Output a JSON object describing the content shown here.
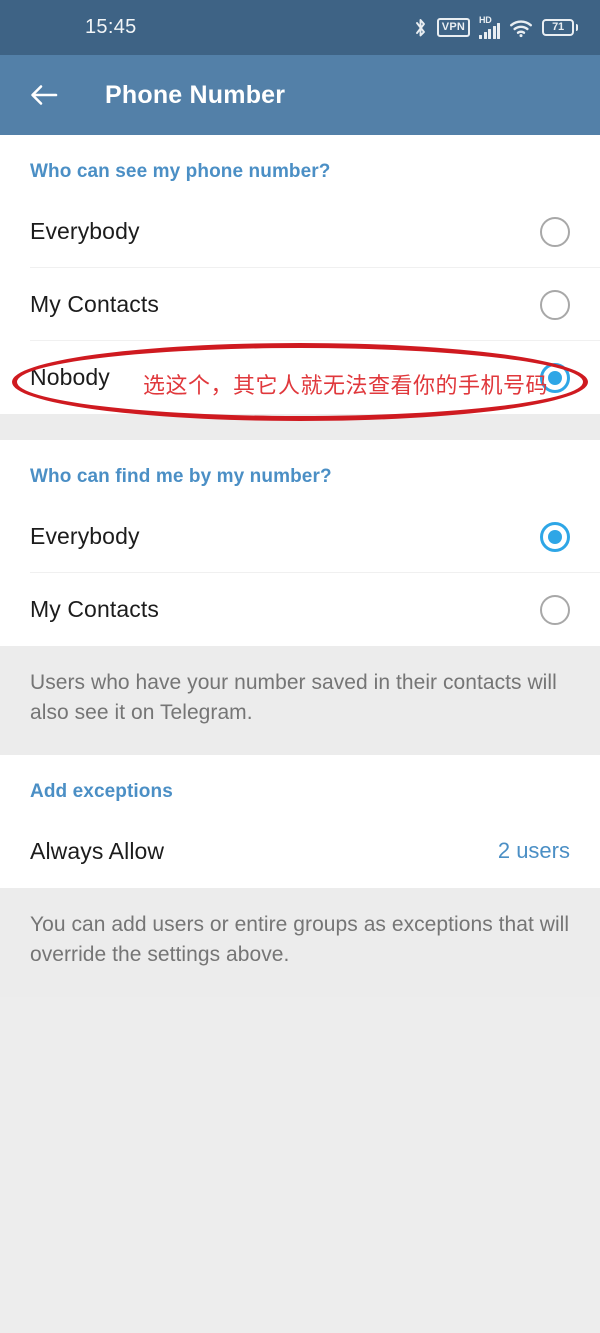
{
  "status_bar": {
    "time": "15:45",
    "battery_level": "71",
    "vpn_label": "VPN",
    "hd_label": "HD",
    "icons": [
      "bluetooth-icon",
      "vpn-icon",
      "hd-signal-icon",
      "wifi-icon",
      "battery-icon"
    ]
  },
  "app_bar": {
    "title": "Phone Number",
    "back_label": "Back"
  },
  "sections": {
    "who_can_see": {
      "header": "Who can see my phone number?",
      "options": [
        {
          "label": "Everybody",
          "selected": false
        },
        {
          "label": "My Contacts",
          "selected": false
        },
        {
          "label": "Nobody",
          "selected": true
        }
      ]
    },
    "who_can_find": {
      "header": "Who can find me by my number?",
      "options": [
        {
          "label": "Everybody",
          "selected": true
        },
        {
          "label": "My Contacts",
          "selected": false
        }
      ],
      "info": "Users who have your number saved in their contacts will also see it on Telegram."
    },
    "add_exceptions": {
      "header": "Add exceptions",
      "row_label": "Always Allow",
      "row_value": "2 users",
      "info": "You can add users or entire groups as exceptions that will override the settings above."
    }
  },
  "annotation": {
    "text": "选这个，其它人就无法查看你的手机号码",
    "color": "#e0383c",
    "ellipse_color": "#cf1a20"
  },
  "colors": {
    "status_bar": "#3e6385",
    "app_bar": "#5380a8",
    "accent_blue": "#4b8fc5",
    "radio_on": "#2ea6e6",
    "page_bg": "#ededed",
    "info_bg": "#ececec"
  }
}
